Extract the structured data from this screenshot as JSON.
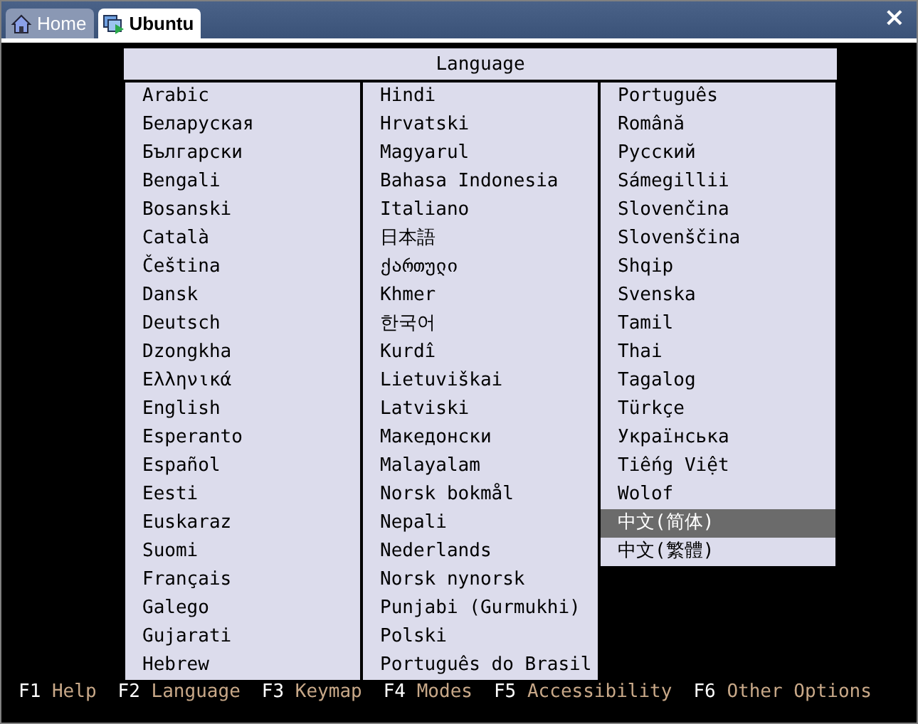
{
  "tabs": [
    {
      "label": "Home",
      "selected": false
    },
    {
      "label": "Ubuntu",
      "selected": true
    }
  ],
  "close": "×",
  "dialog": {
    "title": "Language",
    "columns": [
      [
        {
          "label": "Arabic",
          "selected": false
        },
        {
          "label": "Беларуская",
          "selected": false
        },
        {
          "label": "Български",
          "selected": false
        },
        {
          "label": "Bengali",
          "selected": false
        },
        {
          "label": "Bosanski",
          "selected": false
        },
        {
          "label": "Català",
          "selected": false
        },
        {
          "label": "Čeština",
          "selected": false
        },
        {
          "label": "Dansk",
          "selected": false
        },
        {
          "label": "Deutsch",
          "selected": false
        },
        {
          "label": "Dzongkha",
          "selected": false
        },
        {
          "label": "Ελληνικά",
          "selected": false
        },
        {
          "label": "English",
          "selected": false
        },
        {
          "label": "Esperanto",
          "selected": false
        },
        {
          "label": "Español",
          "selected": false
        },
        {
          "label": "Eesti",
          "selected": false
        },
        {
          "label": "Euskaraz",
          "selected": false
        },
        {
          "label": "Suomi",
          "selected": false
        },
        {
          "label": "Français",
          "selected": false
        },
        {
          "label": "Galego",
          "selected": false
        },
        {
          "label": "Gujarati",
          "selected": false
        },
        {
          "label": "Hebrew",
          "selected": false
        }
      ],
      [
        {
          "label": "Hindi",
          "selected": false
        },
        {
          "label": "Hrvatski",
          "selected": false
        },
        {
          "label": "Magyarul",
          "selected": false
        },
        {
          "label": "Bahasa Indonesia",
          "selected": false
        },
        {
          "label": "Italiano",
          "selected": false
        },
        {
          "label": "日本語",
          "selected": false
        },
        {
          "label": "ქართული",
          "selected": false
        },
        {
          "label": "Khmer",
          "selected": false
        },
        {
          "label": "한국어",
          "selected": false
        },
        {
          "label": "Kurdî",
          "selected": false
        },
        {
          "label": "Lietuviškai",
          "selected": false
        },
        {
          "label": "Latviski",
          "selected": false
        },
        {
          "label": "Македонски",
          "selected": false
        },
        {
          "label": "Malayalam",
          "selected": false
        },
        {
          "label": "Norsk bokmål",
          "selected": false
        },
        {
          "label": "Nepali",
          "selected": false
        },
        {
          "label": "Nederlands",
          "selected": false
        },
        {
          "label": "Norsk nynorsk",
          "selected": false
        },
        {
          "label": "Punjabi (Gurmukhi)",
          "selected": false
        },
        {
          "label": "Polski",
          "selected": false
        },
        {
          "label": "Português do Brasil",
          "selected": false
        }
      ],
      [
        {
          "label": "Português",
          "selected": false
        },
        {
          "label": "Română",
          "selected": false
        },
        {
          "label": "Русский",
          "selected": false
        },
        {
          "label": "Sámegillii",
          "selected": false
        },
        {
          "label": "Slovenčina",
          "selected": false
        },
        {
          "label": "Slovenščina",
          "selected": false
        },
        {
          "label": "Shqip",
          "selected": false
        },
        {
          "label": "Svenska",
          "selected": false
        },
        {
          "label": "Tamil",
          "selected": false
        },
        {
          "label": "Thai",
          "selected": false
        },
        {
          "label": "Tagalog",
          "selected": false
        },
        {
          "label": "Türkçe",
          "selected": false
        },
        {
          "label": "Українська",
          "selected": false
        },
        {
          "label": "Tiếng Việt",
          "selected": false
        },
        {
          "label": "Wolof",
          "selected": false
        },
        {
          "label": "中文(简体)",
          "selected": true
        },
        {
          "label": "中文(繁體)",
          "selected": false
        }
      ]
    ]
  },
  "function_keys": [
    {
      "key": "F1",
      "label": "Help"
    },
    {
      "key": "F2",
      "label": "Language"
    },
    {
      "key": "F3",
      "label": "Keymap"
    },
    {
      "key": "F4",
      "label": "Modes"
    },
    {
      "key": "F5",
      "label": "Accessibility"
    },
    {
      "key": "F6",
      "label": "Other Options"
    }
  ]
}
